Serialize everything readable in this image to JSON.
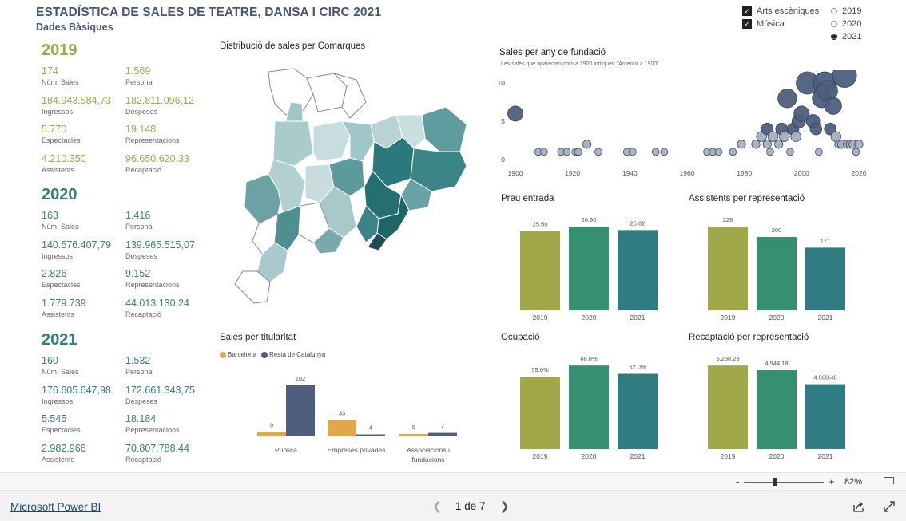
{
  "header": {
    "title": "ESTADÍSTICA DE SALES DE TEATRE, DANSA I CIRC 2021",
    "subtitle": "Dades Bàsiques"
  },
  "filters": {
    "categories": [
      {
        "label": "Arts escèniques",
        "checked": true
      },
      {
        "label": "Música",
        "checked": true
      }
    ],
    "years": [
      {
        "label": "2019",
        "selected": false
      },
      {
        "label": "2020",
        "selected": false
      },
      {
        "label": "2021",
        "selected": true
      }
    ]
  },
  "kpis": [
    {
      "year": "2019",
      "color": "#a0a84a",
      "items": [
        {
          "value": "174",
          "label": "Núm. Sales"
        },
        {
          "value": "1.569",
          "label": "Personal"
        },
        {
          "value": "184.943.584,73",
          "label": "Ingressos"
        },
        {
          "value": "182.811.096,12",
          "label": "Despeses"
        },
        {
          "value": "5.770",
          "label": "Espectacles"
        },
        {
          "value": "19.148",
          "label": "Representacions"
        },
        {
          "value": "4.210.350",
          "label": "Assistents"
        },
        {
          "value": "96.650.620,33",
          "label": "Recaptació"
        }
      ]
    },
    {
      "year": "2020",
      "color": "#35826f",
      "items": [
        {
          "value": "163",
          "label": "Núm. Sales"
        },
        {
          "value": "1.416",
          "label": "Personal"
        },
        {
          "value": "140.576.407,79",
          "label": "Ingressos"
        },
        {
          "value": "139.965.515,07",
          "label": "Despeses"
        },
        {
          "value": "2.826",
          "label": "Espectacles"
        },
        {
          "value": "9.152",
          "label": "Representacions"
        },
        {
          "value": "1.779.739",
          "label": "Assistents"
        },
        {
          "value": "44.013.130,24",
          "label": "Recaptació"
        }
      ]
    },
    {
      "year": "2021",
      "color": "#2f7d83",
      "items": [
        {
          "value": "160",
          "label": "Núm. Sales"
        },
        {
          "value": "1.532",
          "label": "Personal"
        },
        {
          "value": "176.605.647,98",
          "label": "Ingressos"
        },
        {
          "value": "172.661.343,75",
          "label": "Despeses"
        },
        {
          "value": "5.545",
          "label": "Espectacles"
        },
        {
          "value": "18.184",
          "label": "Representacions"
        },
        {
          "value": "2.982.966",
          "label": "Assistents"
        },
        {
          "value": "70.807.788,44",
          "label": "Recaptació"
        }
      ]
    }
  ],
  "map": {
    "title": "Distribució de sales per Comarques"
  },
  "chart_data": [
    {
      "type": "scatter",
      "title": "Sales per any de fundació",
      "subtitle": "Les sales que apareixen com a 1900 indiquen \"Anterior a 1900\"",
      "xlim": [
        1900,
        2020
      ],
      "ylim": [
        0,
        10
      ],
      "xticks": [
        1900,
        1920,
        1940,
        1960,
        1980,
        2000,
        2020
      ],
      "yticks": [
        0,
        5,
        10
      ],
      "points": [
        {
          "x": 1900,
          "y": 6
        },
        {
          "x": 1908,
          "y": 1
        },
        {
          "x": 1910,
          "y": 1
        },
        {
          "x": 1916,
          "y": 1
        },
        {
          "x": 1918,
          "y": 1
        },
        {
          "x": 1921,
          "y": 1
        },
        {
          "x": 1922,
          "y": 1
        },
        {
          "x": 1925,
          "y": 2
        },
        {
          "x": 1929,
          "y": 1
        },
        {
          "x": 1939,
          "y": 1
        },
        {
          "x": 1941,
          "y": 1
        },
        {
          "x": 1949,
          "y": 1
        },
        {
          "x": 1952,
          "y": 1
        },
        {
          "x": 1967,
          "y": 1
        },
        {
          "x": 1969,
          "y": 1
        },
        {
          "x": 1971,
          "y": 1
        },
        {
          "x": 1976,
          "y": 1
        },
        {
          "x": 1979,
          "y": 2
        },
        {
          "x": 1984,
          "y": 2
        },
        {
          "x": 1986,
          "y": 3
        },
        {
          "x": 1988,
          "y": 2
        },
        {
          "x": 1988,
          "y": 4
        },
        {
          "x": 1989,
          "y": 1
        },
        {
          "x": 1990,
          "y": 3
        },
        {
          "x": 1992,
          "y": 2
        },
        {
          "x": 1993,
          "y": 4
        },
        {
          "x": 1994,
          "y": 3
        },
        {
          "x": 1995,
          "y": 8
        },
        {
          "x": 1996,
          "y": 1
        },
        {
          "x": 1997,
          "y": 4
        },
        {
          "x": 1998,
          "y": 3
        },
        {
          "x": 1999,
          "y": 5
        },
        {
          "x": 2000,
          "y": 6
        },
        {
          "x": 2002,
          "y": 10
        },
        {
          "x": 2004,
          "y": 5
        },
        {
          "x": 2005,
          "y": 4
        },
        {
          "x": 2006,
          "y": 1
        },
        {
          "x": 2007,
          "y": 8
        },
        {
          "x": 2008,
          "y": 10
        },
        {
          "x": 2009,
          "y": 9
        },
        {
          "x": 2010,
          "y": 4
        },
        {
          "x": 2011,
          "y": 7
        },
        {
          "x": 2012,
          "y": 3
        },
        {
          "x": 2013,
          "y": 2
        },
        {
          "x": 2014,
          "y": 2
        },
        {
          "x": 2015,
          "y": 11
        },
        {
          "x": 2016,
          "y": 2
        },
        {
          "x": 2017,
          "y": 2
        },
        {
          "x": 2018,
          "y": 2
        },
        {
          "x": 2019,
          "y": 1
        },
        {
          "x": 2020,
          "y": 2
        }
      ]
    },
    {
      "type": "bar",
      "title": "Preu entrada",
      "categories": [
        "2019",
        "2020",
        "2021"
      ],
      "values": [
        25.5,
        26.9,
        25.82
      ],
      "labels": [
        "25.50",
        "26.90",
        "25.82"
      ],
      "colors": [
        "#a0a84a",
        "#35906f",
        "#2f7d83"
      ]
    },
    {
      "type": "bar",
      "title": "Assistents per representació",
      "categories": [
        "2019",
        "2020",
        "2021"
      ],
      "values": [
        228,
        200,
        171
      ],
      "labels": [
        "228",
        "200",
        "171"
      ],
      "colors": [
        "#a0a84a",
        "#35906f",
        "#2f7d83"
      ]
    },
    {
      "type": "bar",
      "title": "Ocupació",
      "categories": [
        "2019",
        "2020",
        "2021"
      ],
      "values": [
        59.6,
        68.8,
        62.0
      ],
      "labels": [
        "59.6%",
        "68.8%",
        "62.0%"
      ],
      "colors": [
        "#a0a84a",
        "#35906f",
        "#2f7d83"
      ]
    },
    {
      "type": "bar",
      "title": "Recaptació per representació",
      "categories": [
        "2019",
        "2020",
        "2021"
      ],
      "values": [
        5238.23,
        4944.18,
        4068.48
      ],
      "labels": [
        "5.238.23",
        "4.944.18",
        "4.068.48"
      ],
      "colors": [
        "#a0a84a",
        "#35906f",
        "#2f7d83"
      ]
    },
    {
      "type": "bar",
      "title": "Sales per titularitat",
      "categories": [
        "Pública",
        "Empreses privades",
        "Associacions i fundacions"
      ],
      "series": [
        {
          "name": "Barcelona",
          "color": "#e1a84a",
          "values": [
            9,
            33,
            5
          ]
        },
        {
          "name": "Resta de Catalunya",
          "color": "#4d5f7d",
          "values": [
            102,
            4,
            7
          ]
        }
      ]
    }
  ],
  "footer": {
    "brand": "Microsoft Power BI",
    "page": "1 de 7",
    "zoom": "82%",
    "zoom_minus": "-",
    "zoom_plus": "+"
  }
}
